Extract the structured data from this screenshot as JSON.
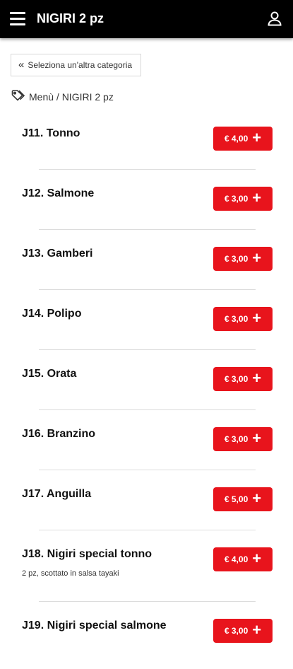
{
  "header": {
    "title": "NIGIRI 2 pz",
    "menu_icon": "hamburger-menu-icon",
    "user_icon": "user-icon"
  },
  "back_button": {
    "label": "Seleziona un'altra categoria",
    "icon": "double-chevron-left-icon"
  },
  "breadcrumb": {
    "icon": "tag-icon",
    "text": "Menù / NIGIRI 2 pz"
  },
  "colors": {
    "accent": "#e8141c",
    "topbar": "#000000"
  },
  "items": [
    {
      "name": "J11. Tonno",
      "price": "€ 4,00",
      "desc": ""
    },
    {
      "name": "J12. Salmone",
      "price": "€ 3,00",
      "desc": ""
    },
    {
      "name": "J13. Gamberi",
      "price": "€ 3,00",
      "desc": ""
    },
    {
      "name": "J14. Polipo",
      "price": "€ 3,00",
      "desc": ""
    },
    {
      "name": "J15. Orata",
      "price": "€ 3,00",
      "desc": ""
    },
    {
      "name": "J16. Branzino",
      "price": "€ 3,00",
      "desc": ""
    },
    {
      "name": "J17. Anguilla",
      "price": "€ 5,00",
      "desc": ""
    },
    {
      "name": "J18. Nigiri special tonno",
      "price": "€ 4,00",
      "desc": "2 pz, scottato in salsa tayaki"
    },
    {
      "name": "J19. Nigiri special salmone",
      "price": "€ 3,00",
      "desc": ""
    }
  ]
}
